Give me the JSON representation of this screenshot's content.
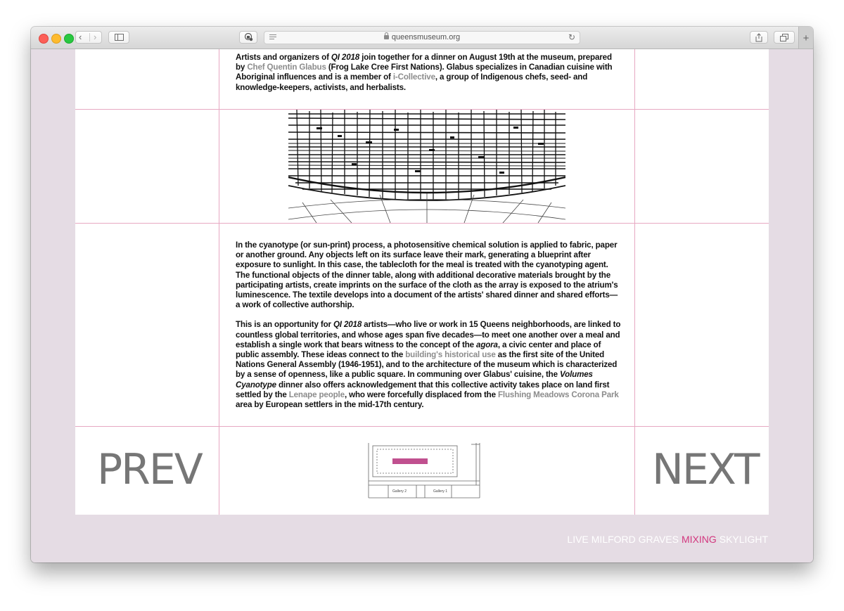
{
  "browser": {
    "url": "queensmuseum.org",
    "new_tab_label": "+"
  },
  "article": {
    "intro": {
      "t1": "Artists and organizers of ",
      "em1": "QI 2018",
      "t2": " join together for a dinner on August 19th at the museum, prepared by ",
      "link1": "Chef Quentin Glabus",
      "t3": " (Frog Lake Cree First Nations). Glabus specializes in Canadian cuisine with Aboriginal influences and is a member of ",
      "link2": "i-Collective",
      "t4": ", a group of Indigenous chefs, seed- and knowledge-keepers, activists, and herbalists."
    },
    "para1": "In the cyanotype (or sun-print) process, a photosensitive chemical solution is applied to fabric, paper or another ground. Any objects left on its surface leave their mark, generating a blueprint after exposure to sunlight. In this case, the tablecloth for the meal is treated with the cyanotyping agent. The functional objects of the dinner table, along with additional decorative materials brought by the participating artists, create imprints on the surface of the cloth as the array is exposed to the atrium's luminescence. The textile develops into a document of the artists' shared dinner and shared efforts—a work of collective authorship.",
    "para2": {
      "t1": "This is an opportunity for ",
      "em1": "QI 2018",
      "t2": " artists—who live or work in 15 Queens neighborhoods, are linked to countless global territories, and whose ages span five decades—to meet one another over a meal and establish a single work that bears witness to the concept of the ",
      "em2": "agora",
      "t3": ", a civic center and place of public assembly. These ideas connect to the ",
      "link1": "building's historical use",
      "t4": " as the first site of the United Nations General Assembly (1946-1951), and to the architecture of the museum which is characterized by a sense of openness, like a public square. In communing over Glabus' cuisine, the ",
      "em3": "Volumes Cyanotype",
      "t5": " dinner also offers acknowledgement that this collective activity takes place on land first settled by the ",
      "link2": "Lenape people",
      "t6": ", who were forcefully displaced from the ",
      "link3": "Flushing Meadows Corona Park",
      "t7": " area by European settlers in the mid-17th century."
    }
  },
  "nav": {
    "prev": "PREV",
    "next": "NEXT"
  },
  "floorplan": {
    "gallery2": "Gallery 2",
    "gallery1": "Gallery 1"
  },
  "footer": {
    "items": [
      "LIVE",
      "MILFORD GRAVES",
      "MIXING",
      "SKYLIGHT"
    ],
    "active_color": "#d2377e"
  },
  "colors": {
    "grid_line": "#e7a8c2",
    "page_bg": "#e5dce4",
    "link": "#8c8c8c",
    "accent": "#c0508f"
  }
}
